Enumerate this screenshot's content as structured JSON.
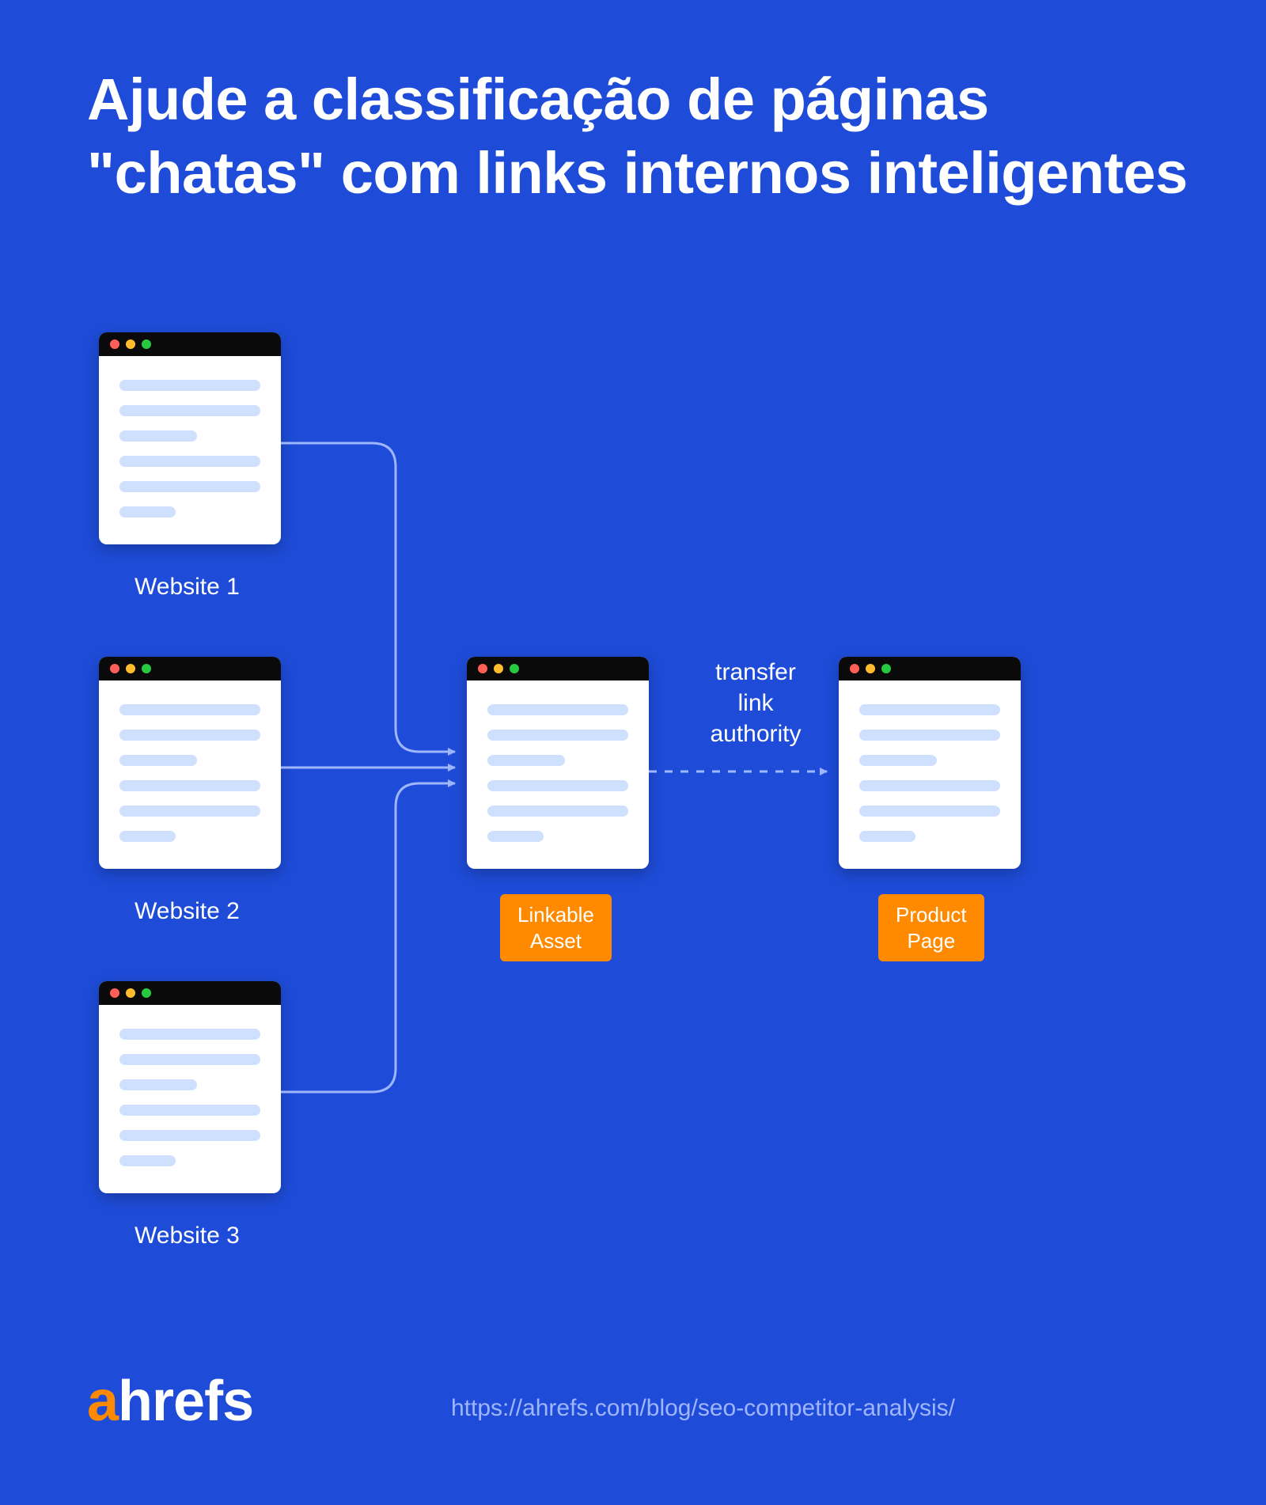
{
  "title": "Ajude a classificação de páginas \"chatas\" com links internos inteligentes",
  "websites": {
    "w1": "Website 1",
    "w2": "Website 2",
    "w3": "Website 3"
  },
  "linkable_asset_label": "Linkable\nAsset",
  "product_page_label": "Product\nPage",
  "transfer_label": "transfer\nlink\nauthority",
  "logo": {
    "accent": "a",
    "rest": "hrefs"
  },
  "footer_url": "https://ahrefs.com/blog/seo-competitor-analysis/"
}
